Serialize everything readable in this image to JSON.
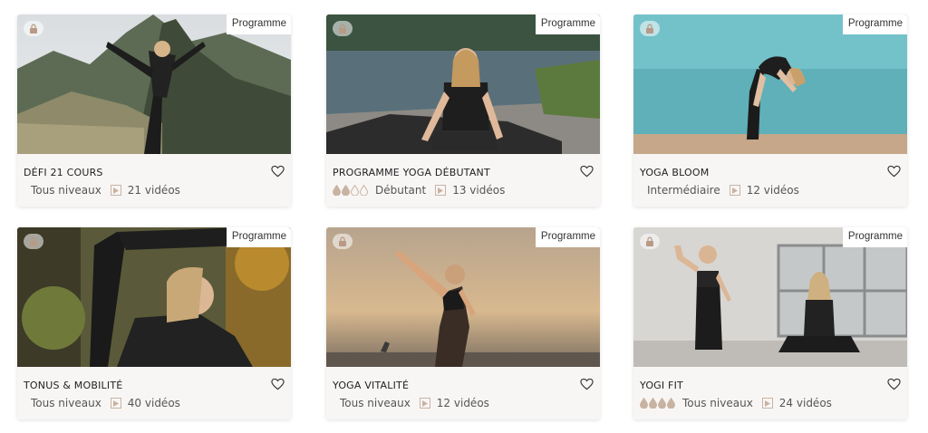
{
  "cards": [
    {
      "badge": "Programme",
      "title": "DÉFI 21 COURS",
      "level": "Tous niveaux",
      "videos": "21 vidéos",
      "difficulty_filled": 0,
      "show_drops": false
    },
    {
      "badge": "Programme",
      "title": "PROGRAMME YOGA DÉBUTANT",
      "level": "Débutant",
      "videos": "13 vidéos",
      "difficulty_filled": 2,
      "show_drops": true
    },
    {
      "badge": "Programme",
      "title": "YOGA BLOOM",
      "level": "Intermédiaire",
      "videos": "12 vidéos",
      "difficulty_filled": 0,
      "show_drops": false
    },
    {
      "badge": "Programme",
      "title": "TONUS & MOBILITÉ",
      "level": "Tous niveaux",
      "videos": "40 vidéos",
      "difficulty_filled": 0,
      "show_drops": false
    },
    {
      "badge": "Programme",
      "title": "YOGA VITALITÉ",
      "level": "Tous niveaux",
      "videos": "12 vidéos",
      "difficulty_filled": 0,
      "show_drops": false
    },
    {
      "badge": "Programme",
      "title": "YOGI FIT",
      "level": "Tous niveaux",
      "videos": "24 vidéos",
      "difficulty_filled": 4,
      "show_drops": true
    }
  ],
  "icons": {
    "lock": "lock-icon",
    "heart": "heart-icon",
    "play": "play-icon",
    "drop": "drop-icon"
  },
  "colors": {
    "accent": "#c8b3a3",
    "card_bg": "#f8f6f5",
    "text": "#222222"
  }
}
